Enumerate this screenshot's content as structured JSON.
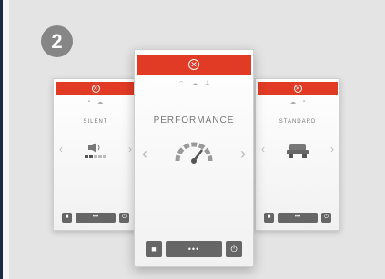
{
  "badge": {
    "number": "2"
  },
  "phones": {
    "left": {
      "mode": "SILENT"
    },
    "center": {
      "mode": "PERFORMANCE"
    },
    "right": {
      "mode": "STANDARD"
    }
  },
  "controls": {
    "menu_label": "•••"
  },
  "icons": [
    "close-icon",
    "wifi-icon",
    "cloud-icon",
    "signal-icon",
    "speaker-icon",
    "speedometer-icon",
    "car-icon",
    "lock-icon",
    "power-icon",
    "chevron-left-icon",
    "chevron-right-icon"
  ],
  "colors": {
    "topbar": "#e13a25",
    "badge": "#868686",
    "button": "#666666",
    "background": "#e4e4e4"
  }
}
